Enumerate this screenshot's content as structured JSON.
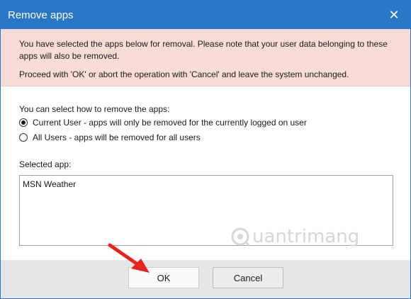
{
  "window": {
    "title": "Remove apps",
    "close_glyph": "✕"
  },
  "warning": {
    "line1": "You have selected the apps below for removal. Please note that your user data belonging to these apps will also be removed.",
    "line2": "Proceed with 'OK' or abort the operation with 'Cancel' and leave the system unchanged."
  },
  "options": {
    "label": "You can select how to remove the apps:",
    "current_user": "Current User - apps will only be removed for the currently logged on user",
    "all_users": "All Users - apps will be removed for all users",
    "selected": "current_user"
  },
  "selected_apps": {
    "label": "Selected app:",
    "items": [
      "MSN Weather"
    ]
  },
  "buttons": {
    "ok": "OK",
    "cancel": "Cancel"
  },
  "watermark": {
    "text": "uantrimang"
  },
  "colors": {
    "titlebar": "#2b77c7",
    "warning_bg": "#f9dcd6",
    "arrow": "#e8231f"
  }
}
